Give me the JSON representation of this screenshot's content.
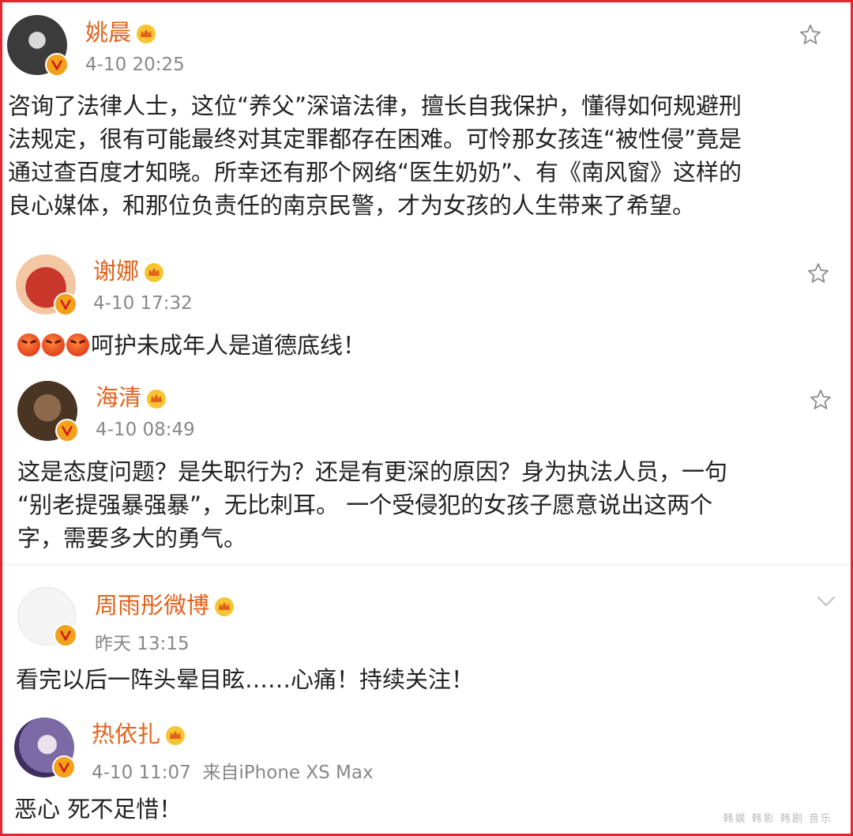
{
  "comments": [
    {
      "name": "姚晨",
      "time": "4-10 20:25",
      "source": "",
      "lines": [
        "咨询了法律人士，这位“养父”深谙法律，擅长自我保护，懂得如何规避刑",
        "法规定，很有可能最终对其定罪都存在困难。可怜那女孩连“被性侵”竟是",
        "通过查百度才知晓。所幸还有那个网络“医生奶奶”、有《南风窗》这样的",
        "良心媒体，和那位负责任的南京民警，才为女孩的人生带来了希望。"
      ]
    },
    {
      "name": "谢娜",
      "time": "4-10 17:32",
      "source": "",
      "lines": [
        "呵护未成年人是道德底线！"
      ],
      "emoji_count": 3
    },
    {
      "name": "海清",
      "time": "4-10 08:49",
      "source": "",
      "lines": [
        "这是态度问题？是失职行为？还是有更深的原因？身为执法人员，一句",
        "“别老提强暴强暴”，无比刺耳。 一个受侵犯的女孩子愿意说出这两个",
        "字，需要多大的勇气。"
      ]
    },
    {
      "name": "周雨彤微博",
      "time": "昨天 13:15",
      "source": "",
      "lines": [
        "看完以后一阵头晕目眩……心痛！持续关注！"
      ]
    },
    {
      "name": "热依扎",
      "time": "4-10 11:07",
      "source": "来自iPhone XS Max",
      "lines": [
        "恶心 死不足惜！"
      ]
    }
  ],
  "watermark": "韩娱 韩影 韩剧 音乐",
  "colors": {
    "name": "#e2621b",
    "meta": "#888888",
    "text": "#222222",
    "frame": "#e8242c",
    "badge": "#f2a31b"
  }
}
